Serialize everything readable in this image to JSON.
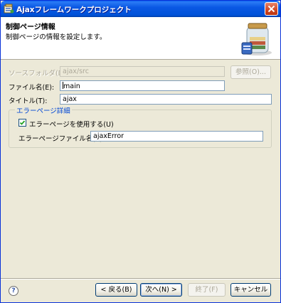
{
  "window": {
    "title": "Ajaxフレームワークプロジェクト",
    "icon": "wizard-icon",
    "close_icon": "close-icon"
  },
  "banner": {
    "title": "制御ページ情報",
    "description": "制御ページの情報を設定します。",
    "graphic": "jar-wizard-icon"
  },
  "form": {
    "source_folder": {
      "label": "ソースフォルダ(D):",
      "value": "ajax/src",
      "disabled": true
    },
    "browse_button": {
      "label": "参照(O)...",
      "disabled": true
    },
    "file_name": {
      "label": "ファイル名(E):",
      "value": "main"
    },
    "title": {
      "label": "タイトル(T):",
      "value": "ajax"
    }
  },
  "error_group": {
    "legend": "エラーページ詳細",
    "use_error_page": {
      "label": "エラーページを使用する(U)",
      "checked": true
    },
    "error_file": {
      "label": "エラーページファイル名(E):",
      "value": "ajaxError"
    }
  },
  "footer": {
    "help_icon": "help-icon",
    "back": "< 戻る(B)",
    "next": "次へ(N) >",
    "finish": "終了(F)",
    "cancel": "キャンセル"
  }
}
